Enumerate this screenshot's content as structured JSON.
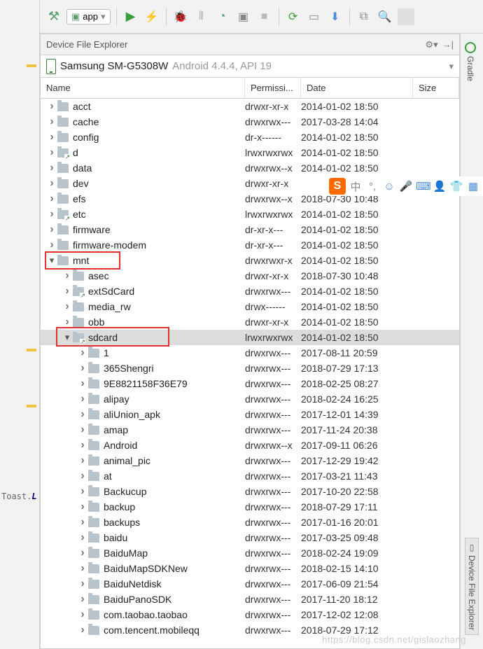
{
  "toolbar": {
    "module": "app"
  },
  "panel": {
    "title": "Device File Explorer"
  },
  "device": {
    "name": "Samsung SM-G5308W",
    "meta": "Android 4.4.4, API 19"
  },
  "columns": {
    "name": "Name",
    "perm": "Permissi...",
    "date": "Date",
    "size": "Size"
  },
  "code_hint_prefix": "Toast.",
  "code_hint_kw": "L",
  "rail": {
    "gradle": "Gradle",
    "dfe": "Device File Explorer"
  },
  "watermark": "https://blog.csdn.net/gislaozhang",
  "float_s": "S",
  "rows": [
    {
      "depth": 0,
      "expand": "right",
      "link": false,
      "name": "acct",
      "perm": "drwxr-xr-x",
      "date": "2014-01-02 18:50"
    },
    {
      "depth": 0,
      "expand": "right",
      "link": false,
      "name": "cache",
      "perm": "drwxrwx---",
      "date": "2017-03-28 14:04"
    },
    {
      "depth": 0,
      "expand": "right",
      "link": false,
      "name": "config",
      "perm": "dr-x------",
      "date": "2014-01-02 18:50"
    },
    {
      "depth": 0,
      "expand": "right",
      "link": true,
      "name": "d",
      "perm": "lrwxrwxrwx",
      "date": "2014-01-02 18:50"
    },
    {
      "depth": 0,
      "expand": "right",
      "link": false,
      "name": "data",
      "perm": "drwxrwx--x",
      "date": "2014-01-02 18:50"
    },
    {
      "depth": 0,
      "expand": "right",
      "link": false,
      "name": "dev",
      "perm": "drwxr-xr-x",
      "date": ""
    },
    {
      "depth": 0,
      "expand": "right",
      "link": false,
      "name": "efs",
      "perm": "drwxrwx--x",
      "date": "2018-07-30 10:48"
    },
    {
      "depth": 0,
      "expand": "right",
      "link": true,
      "name": "etc",
      "perm": "lrwxrwxrwx",
      "date": "2014-01-02 18:50"
    },
    {
      "depth": 0,
      "expand": "right",
      "link": false,
      "name": "firmware",
      "perm": "dr-xr-x---",
      "date": "2014-01-02 18:50"
    },
    {
      "depth": 0,
      "expand": "right",
      "link": false,
      "name": "firmware-modem",
      "perm": "dr-xr-x---",
      "date": "2014-01-02 18:50"
    },
    {
      "depth": 0,
      "expand": "down",
      "link": false,
      "name": "mnt",
      "perm": "drwxrwxr-x",
      "date": "2014-01-02 18:50"
    },
    {
      "depth": 1,
      "expand": "right",
      "link": false,
      "name": "asec",
      "perm": "drwxr-xr-x",
      "date": "2018-07-30 10:48"
    },
    {
      "depth": 1,
      "expand": "right",
      "link": true,
      "name": "extSdCard",
      "perm": "drwxrwx---",
      "date": "2014-01-02 18:50"
    },
    {
      "depth": 1,
      "expand": "right",
      "link": false,
      "name": "media_rw",
      "perm": "drwx------",
      "date": "2014-01-02 18:50"
    },
    {
      "depth": 1,
      "expand": "right",
      "link": false,
      "name": "obb",
      "perm": "drwxr-xr-x",
      "date": "2014-01-02 18:50"
    },
    {
      "depth": 1,
      "expand": "down",
      "link": true,
      "name": "sdcard",
      "perm": "lrwxrwxrwx",
      "date": "2014-01-02 18:50",
      "selected": true
    },
    {
      "depth": 2,
      "expand": "right",
      "link": false,
      "name": "1",
      "perm": "drwxrwx---",
      "date": "2017-08-11 20:59"
    },
    {
      "depth": 2,
      "expand": "right",
      "link": false,
      "name": "365Shengri",
      "perm": "drwxrwx---",
      "date": "2018-07-29 17:13"
    },
    {
      "depth": 2,
      "expand": "right",
      "link": false,
      "name": "9E8821158F36E79",
      "perm": "drwxrwx---",
      "date": "2018-02-25 08:27"
    },
    {
      "depth": 2,
      "expand": "right",
      "link": false,
      "name": "alipay",
      "perm": "drwxrwx---",
      "date": "2018-02-24 16:25"
    },
    {
      "depth": 2,
      "expand": "right",
      "link": false,
      "name": "aliUnion_apk",
      "perm": "drwxrwx---",
      "date": "2017-12-01 14:39"
    },
    {
      "depth": 2,
      "expand": "right",
      "link": false,
      "name": "amap",
      "perm": "drwxrwx---",
      "date": "2017-11-24 20:38"
    },
    {
      "depth": 2,
      "expand": "right",
      "link": false,
      "name": "Android",
      "perm": "drwxrwx--x",
      "date": "2017-09-11 06:26"
    },
    {
      "depth": 2,
      "expand": "right",
      "link": false,
      "name": "animal_pic",
      "perm": "drwxrwx---",
      "date": "2017-12-29 19:42"
    },
    {
      "depth": 2,
      "expand": "right",
      "link": false,
      "name": "at",
      "perm": "drwxrwx---",
      "date": "2017-03-21 11:43"
    },
    {
      "depth": 2,
      "expand": "right",
      "link": false,
      "name": "Backucup",
      "perm": "drwxrwx---",
      "date": "2017-10-20 22:58"
    },
    {
      "depth": 2,
      "expand": "right",
      "link": false,
      "name": "backup",
      "perm": "drwxrwx---",
      "date": "2018-07-29 17:11"
    },
    {
      "depth": 2,
      "expand": "right",
      "link": false,
      "name": "backups",
      "perm": "drwxrwx---",
      "date": "2017-01-16 20:01"
    },
    {
      "depth": 2,
      "expand": "right",
      "link": false,
      "name": "baidu",
      "perm": "drwxrwx---",
      "date": "2017-03-25 09:48"
    },
    {
      "depth": 2,
      "expand": "right",
      "link": false,
      "name": "BaiduMap",
      "perm": "drwxrwx---",
      "date": "2018-02-24 19:09"
    },
    {
      "depth": 2,
      "expand": "right",
      "link": false,
      "name": "BaiduMapSDKNew",
      "perm": "drwxrwx---",
      "date": "2018-02-15 14:10"
    },
    {
      "depth": 2,
      "expand": "right",
      "link": false,
      "name": "BaiduNetdisk",
      "perm": "drwxrwx---",
      "date": "2017-06-09 21:54"
    },
    {
      "depth": 2,
      "expand": "right",
      "link": false,
      "name": "BaiduPanoSDK",
      "perm": "drwxrwx---",
      "date": "2017-11-20 18:12"
    },
    {
      "depth": 2,
      "expand": "right",
      "link": false,
      "name": "com.taobao.taobao",
      "perm": "drwxrwx---",
      "date": "2017-12-02 12:08"
    },
    {
      "depth": 2,
      "expand": "right",
      "link": false,
      "name": "com.tencent.mobileqq",
      "perm": "drwxrwx---",
      "date": "2018-07-29 17:12"
    }
  ]
}
